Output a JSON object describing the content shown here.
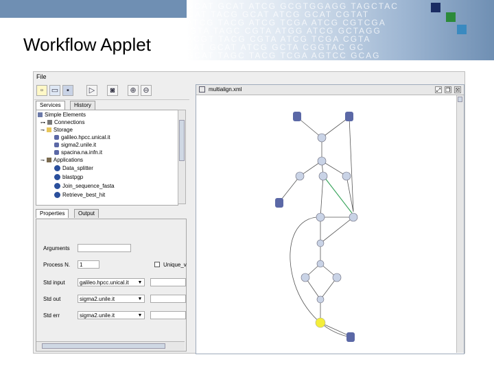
{
  "slide": {
    "title": "Workflow Applet"
  },
  "banner": {
    "dna_lines": [
      "GCAT GCAT ATCG GCGTGGAGG TAGCTAC",
      "GCAT TACG GCAT ATCG GCAT CGTAT",
      "ATCG TACG ATCG TCGA ATCG CGTCGA",
      "CGTA TAGC CGTA ATGG ATCG GCTAGG",
      "ACGT TACG CGTA ATCG TCGA CGTA",
      "GCAT GCAT ATCG GCTA CGGTAC GC",
      "GCAT TAGC TACG TCGA AGTCC GCAG"
    ],
    "accent_letters": [
      "A",
      "T",
      "G",
      "A"
    ]
  },
  "app": {
    "menu": {
      "file": "File"
    },
    "toolbar": {
      "icons": [
        "new-icon",
        "open-icon",
        "save-icon",
        "run-icon",
        "camera-icon",
        "zoom-in-icon",
        "zoom-out-icon"
      ]
    },
    "left_tabs": {
      "services": "Services",
      "history": "History"
    },
    "tree": {
      "root": "Simple Elements",
      "connections": "Connections",
      "storage": "Storage",
      "storage_items": [
        "galileo.hpcc.unical.it",
        "sigma2.unile.it",
        "spacina.na.infn.it"
      ],
      "applications": "Applications",
      "application_items": [
        "Data_splitter",
        "blastpgp",
        "Join_sequence_fasta",
        "Retrieve_best_hit"
      ]
    },
    "props_tabs": {
      "properties": "Properties",
      "output": "Output"
    },
    "props": {
      "arguments_label": "Arguments",
      "arguments_value": "",
      "process_label": "Process N.",
      "process_value": "1",
      "unique_label": "Unique_v",
      "stdin_label": "Std input",
      "stdin_value": "galileo.hpcc.unical.it",
      "stdout_label": "Std out",
      "stdout_value": "sigma2.unile.it",
      "stderr_label": "Std err",
      "stderr_value": "sigma2.unile.it"
    },
    "canvas": {
      "filename": "multialign.xml",
      "controls": [
        "⤢",
        "❐",
        "☒"
      ]
    },
    "colors": {
      "node": "#c9d3e6",
      "highlight_node": "#f4ee3a",
      "connector": "#3aa55d"
    }
  }
}
